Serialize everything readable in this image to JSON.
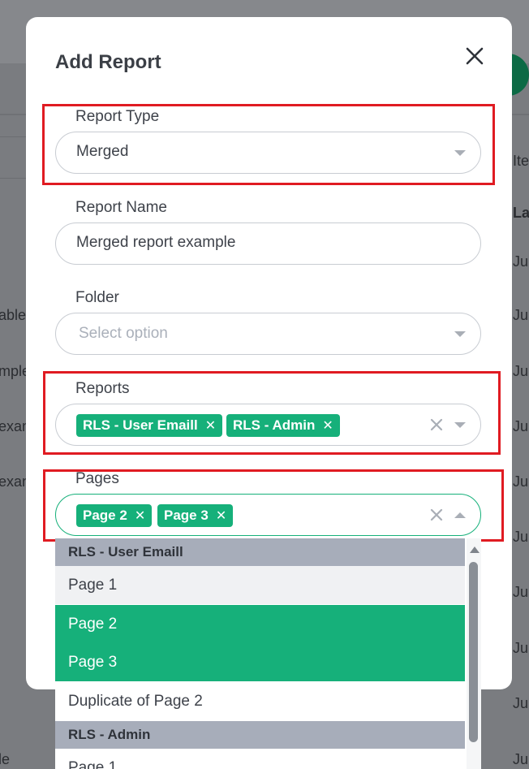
{
  "background": {
    "left_fragments": [
      "able",
      "mple",
      "exam",
      "exan",
      "le"
    ],
    "right_fragments": [
      "Ite",
      "La",
      "Jul",
      "Jul",
      "Jul",
      "Jul",
      "Jul",
      "Jul",
      "Jul",
      "Jul",
      "Jul",
      "Jul",
      "Jul"
    ]
  },
  "modal": {
    "title": "Add Report",
    "close_icon": "close-icon"
  },
  "fields": {
    "report_type": {
      "label": "Report Type",
      "value": "Merged"
    },
    "report_name": {
      "label": "Report Name",
      "value": "Merged report example"
    },
    "folder": {
      "label": "Folder",
      "placeholder": "Select option"
    },
    "reports": {
      "label": "Reports",
      "tags": [
        "RLS - User Emaill",
        "RLS - Admin"
      ]
    },
    "pages": {
      "label": "Pages",
      "tags": [
        "Page 2",
        "Page 3"
      ]
    }
  },
  "dropdown": {
    "groups": [
      {
        "name": "RLS - User Emaill",
        "options": [
          "Page 1",
          "Page 2",
          "Page 3",
          "Duplicate of Page 2"
        ]
      },
      {
        "name": "RLS - Admin",
        "options": [
          "Page 1"
        ]
      }
    ],
    "selected": [
      "Page 2",
      "Page 3"
    ]
  },
  "colors": {
    "accent": "#16b07a",
    "highlight": "#e01b22",
    "group_header": "#a7adba"
  }
}
